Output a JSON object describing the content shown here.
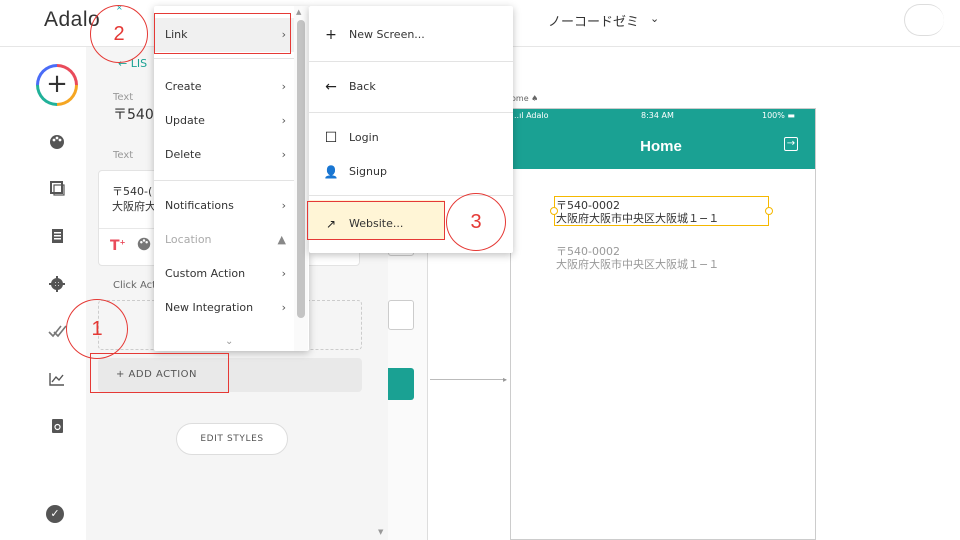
{
  "header": {
    "logo": "Adalo",
    "logo_mark": "×",
    "app_name": "ノーコードゼミ",
    "app_chevron": "⌄"
  },
  "rail": {
    "add_icon": "+",
    "icons": [
      "palette-icon",
      "screens-icon",
      "database-icon",
      "settings-icon",
      "publish-icon",
      "analytics-icon",
      "copy-icon"
    ],
    "verified_icon": "✓"
  },
  "panel": {
    "back_label": "← LIS",
    "field1_label": "Text",
    "field1_value": "〒540",
    "field2_label": "Text",
    "card_line1": "〒540-(",
    "card_line2": "大阪府大",
    "click_actions_label": "Click Act",
    "add_action_label": "+  ADD ACTION",
    "edit_styles_label": "EDIT STYLES"
  },
  "annotations": {
    "step1": "1",
    "step2": "2",
    "step3": "3"
  },
  "menu": {
    "items": [
      {
        "label": "Link",
        "chevron": "›"
      },
      {
        "label": "Create",
        "chevron": "›"
      },
      {
        "label": "Update",
        "chevron": "›"
      },
      {
        "label": "Delete",
        "chevron": "›"
      },
      {
        "label": "Notifications",
        "chevron": "›"
      },
      {
        "label": "Location",
        "chevron": "▲"
      },
      {
        "label": "Custom Action",
        "chevron": "›"
      },
      {
        "label": "New Integration",
        "chevron": "›"
      }
    ],
    "more_icon": "⌄"
  },
  "submenu": {
    "items": [
      {
        "icon": "+",
        "label": "New Screen..."
      },
      {
        "icon": "←",
        "label": "Back"
      },
      {
        "icon": "☐",
        "label": "Login"
      },
      {
        "icon": "👤",
        "label": "Signup"
      },
      {
        "icon": "↗",
        "label": "Website..."
      }
    ]
  },
  "phone": {
    "screen_label": "ome ♠",
    "status_carrier": "..ıl Adalo",
    "status_time": "8:34 AM",
    "status_battery": "100% ▬",
    "title": "Home",
    "logout_icon": "→",
    "selected_line1": "〒540-0002",
    "selected_line2": "大阪府大阪市中央区大阪城１−１",
    "plain_line1": "〒540-0002",
    "plain_line2": "大阪府大阪市中央区大阪城１−１"
  },
  "colors": {
    "accent": "#1aa193",
    "highlight": "#e53935",
    "selection": "#f5b800"
  }
}
